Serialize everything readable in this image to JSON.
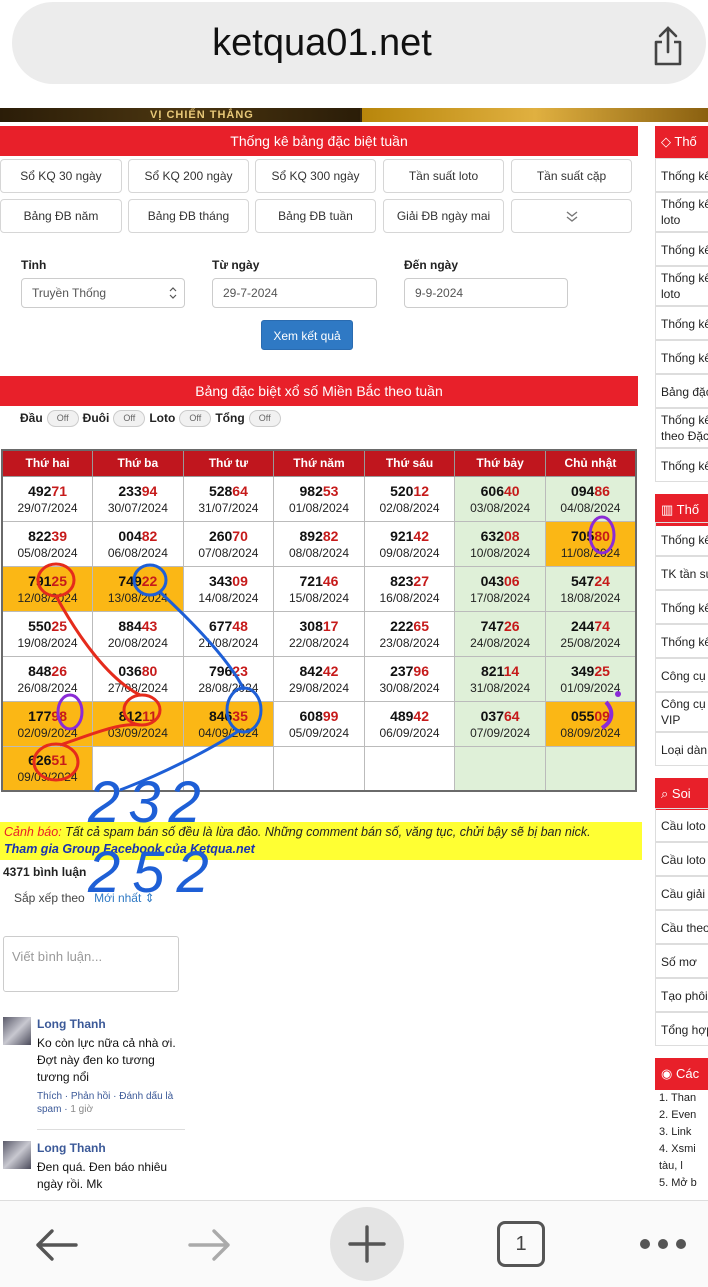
{
  "browser": {
    "url": "ketqua01.net",
    "tab_count": "1"
  },
  "banner": {
    "text": "VỊ CHIẾN THẮNG"
  },
  "stats": {
    "header": "Thống kê bảng đặc biệt tuần",
    "buttons": [
      "Sổ KQ 30 ngày",
      "Sổ KQ 200 ngày",
      "Sổ KQ 300 ngày",
      "Tần suất loto",
      "Tần suất cặp",
      "Bảng ĐB năm",
      "Bảng ĐB tháng",
      "Bảng ĐB tuần",
      "Giải ĐB ngày mai"
    ]
  },
  "form": {
    "province_label": "Tỉnh",
    "province_value": "Truyền Thống",
    "from_label": "Từ ngày",
    "from_value": "29-7-2024",
    "to_label": "Đến ngày",
    "to_value": "9-9-2024",
    "submit": "Xem kết quả"
  },
  "table": {
    "header": "Bảng đặc biệt xổ số Miền Bắc theo tuần",
    "toggles": [
      {
        "label": "Đầu",
        "state": "Off"
      },
      {
        "label": "Đuôi",
        "state": "Off"
      },
      {
        "label": "Loto",
        "state": "Off"
      },
      {
        "label": "Tổng",
        "state": "Off"
      }
    ],
    "days": [
      "Thứ hai",
      "Thứ ba",
      "Thứ tư",
      "Thứ năm",
      "Thứ sáu",
      "Thứ bảy",
      "Chủ nhật"
    ],
    "rows": [
      [
        {
          "head": "492",
          "tail": "71",
          "date": "29/07/2024"
        },
        {
          "head": "233",
          "tail": "94",
          "date": "30/07/2024"
        },
        {
          "head": "528",
          "tail": "64",
          "date": "31/07/2024"
        },
        {
          "head": "982",
          "tail": "53",
          "date": "01/08/2024"
        },
        {
          "head": "520",
          "tail": "12",
          "date": "02/08/2024"
        },
        {
          "head": "606",
          "tail": "40",
          "date": "03/08/2024"
        },
        {
          "head": "094",
          "tail": "86",
          "date": "04/08/2024"
        }
      ],
      [
        {
          "head": "822",
          "tail": "39",
          "date": "05/08/2024"
        },
        {
          "head": "004",
          "tail": "82",
          "date": "06/08/2024"
        },
        {
          "head": "260",
          "tail": "70",
          "date": "07/08/2024"
        },
        {
          "head": "892",
          "tail": "82",
          "date": "08/08/2024"
        },
        {
          "head": "921",
          "tail": "42",
          "date": "09/08/2024"
        },
        {
          "head": "632",
          "tail": "08",
          "date": "10/08/2024"
        },
        {
          "head": "705",
          "tail": "80",
          "date": "11/08/2024",
          "hl": true
        }
      ],
      [
        {
          "head": "791",
          "tail": "25",
          "date": "12/08/2024",
          "hl": true
        },
        {
          "head": "749",
          "tail": "22",
          "date": "13/08/2024",
          "hl": true
        },
        {
          "head": "343",
          "tail": "09",
          "date": "14/08/2024"
        },
        {
          "head": "721",
          "tail": "46",
          "date": "15/08/2024"
        },
        {
          "head": "823",
          "tail": "27",
          "date": "16/08/2024"
        },
        {
          "head": "043",
          "tail": "06",
          "date": "17/08/2024"
        },
        {
          "head": "547",
          "tail": "24",
          "date": "18/08/2024"
        }
      ],
      [
        {
          "head": "550",
          "tail": "25",
          "date": "19/08/2024"
        },
        {
          "head": "884",
          "tail": "43",
          "date": "20/08/2024"
        },
        {
          "head": "677",
          "tail": "48",
          "date": "21/08/2024"
        },
        {
          "head": "308",
          "tail": "17",
          "date": "22/08/2024"
        },
        {
          "head": "222",
          "tail": "65",
          "date": "23/08/2024"
        },
        {
          "head": "747",
          "tail": "26",
          "date": "24/08/2024"
        },
        {
          "head": "244",
          "tail": "74",
          "date": "25/08/2024"
        }
      ],
      [
        {
          "head": "848",
          "tail": "26",
          "date": "26/08/2024"
        },
        {
          "head": "036",
          "tail": "80",
          "date": "27/08/2024"
        },
        {
          "head": "796",
          "tail": "23",
          "date": "28/08/2024"
        },
        {
          "head": "842",
          "tail": "42",
          "date": "29/08/2024"
        },
        {
          "head": "237",
          "tail": "96",
          "date": "30/08/2024"
        },
        {
          "head": "821",
          "tail": "14",
          "date": "31/08/2024"
        },
        {
          "head": "349",
          "tail": "25",
          "date": "01/09/2024"
        }
      ],
      [
        {
          "head": "177",
          "tail": "98",
          "date": "02/09/2024",
          "hl": true
        },
        {
          "head": "812",
          "tail": "11",
          "date": "03/09/2024",
          "hl": true
        },
        {
          "head": "846",
          "tail": "35",
          "date": "04/09/2024",
          "hl": true
        },
        {
          "head": "608",
          "tail": "99",
          "date": "05/09/2024"
        },
        {
          "head": "489",
          "tail": "42",
          "date": "06/09/2024"
        },
        {
          "head": "037",
          "tail": "64",
          "date": "07/09/2024"
        },
        {
          "head": "055",
          "tail": "09",
          "date": "08/09/2024",
          "hl": true
        }
      ],
      [
        {
          "head": "626",
          "tail": "51",
          "date": "09/09/2024",
          "hl": true
        },
        null,
        null,
        null,
        null,
        null,
        null
      ]
    ]
  },
  "warning": {
    "label": "Cảnh báo:",
    "text": "Tất cả spam bán số đều là lừa đảo. Những comment bán số, văng tục, chửi bậy sẽ bị ban nick.",
    "link": "Tham gia Group Facebook của Ketqua.net"
  },
  "comments": {
    "count": "4371 bình luận",
    "sort_label": "Sắp xếp theo",
    "sort_value": "Mới nhất",
    "placeholder": "Viết bình luận...",
    "items": [
      {
        "author": "Long Thanh",
        "text": "Ko còn lực nữa cả nhà ơi. Đợt này đen ko tương tương nổi",
        "actions": "Thích · Phản hồi · Đánh dấu là spam · ",
        "time": "1 giờ"
      },
      {
        "author": "Long Thanh",
        "text": "Đen quá. Đen báo nhiêu ngày rồi. Mk",
        "actions": "",
        "time": ""
      }
    ]
  },
  "sidebar": {
    "heads": [
      "Thố",
      "Thố",
      "Soi",
      "Các"
    ],
    "items1": [
      "Thống kê",
      "Thống kê loto",
      "Thống kê",
      "Thống kê loto",
      "Thống kê",
      "Thống kê",
      "Bảng đặc",
      "Thống kê theo Đặc",
      "Thống kê"
    ],
    "items2": [
      "Thống kê",
      "TK tần su",
      "Thống kê",
      "Thống kê",
      "Công cụ",
      "Công cụ VIP",
      "Loại dàn"
    ],
    "items3": [
      "Cầu loto",
      "Cầu loto",
      "Cầu giải",
      "Cầu theo",
      "Số mơ",
      "Tạo phôi",
      "Tổng hợp"
    ],
    "list": [
      "1. Than",
      "2. Even",
      "3. Link",
      "4. Xsmi",
      "tàu, l",
      "5. Mở b"
    ]
  },
  "handwriting": {
    "line1": "232",
    "line2": "252"
  },
  "colors": {
    "red": "#e8202a",
    "highlight": "#fbb715",
    "weekend": "#dff0d8",
    "blue": "#2f79c4"
  },
  "icons": [
    "share-icon",
    "diamond-icon",
    "chart-icon",
    "search-icon",
    "users-icon",
    "back-arrow-icon",
    "forward-arrow-icon",
    "plus-icon",
    "tabs-icon",
    "more-icon",
    "chevron-down-icon",
    "select-arrow-icon"
  ]
}
